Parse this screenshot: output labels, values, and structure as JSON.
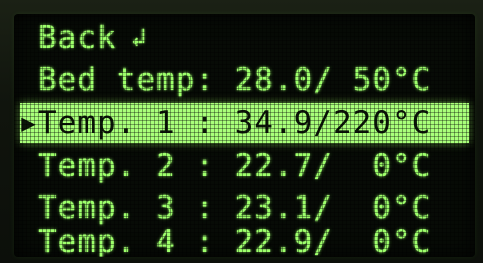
{
  "menu": {
    "back": {
      "label": "Back",
      "icon": "return-arrow-icon",
      "glyph": "↲"
    },
    "items": [
      {
        "label": "Bed temp",
        "sep": ": ",
        "current": "28.0",
        "target": " 50",
        "unit": "°C",
        "selected": false
      },
      {
        "label": "Temp. 1 ",
        "sep": ": ",
        "current": "34.9",
        "target": "220",
        "unit": "°C",
        "selected": true
      },
      {
        "label": "Temp. 2 ",
        "sep": ": ",
        "current": "22.7",
        "target": "  0",
        "unit": "°C",
        "selected": false
      },
      {
        "label": "Temp. 3 ",
        "sep": ": ",
        "current": "23.1",
        "target": "  0",
        "unit": "°C",
        "selected": false
      },
      {
        "label": "Temp. 4 ",
        "sep": ": ",
        "current": "22.9",
        "target": "  0",
        "unit": "°C",
        "selected": false
      }
    ],
    "cursor_glyph": "▶"
  },
  "colors": {
    "lcd_fg": "#9dff6b",
    "lcd_bg": "#070b06",
    "highlight_bg": "#a9ff7a",
    "highlight_fg": "#0b1608"
  }
}
